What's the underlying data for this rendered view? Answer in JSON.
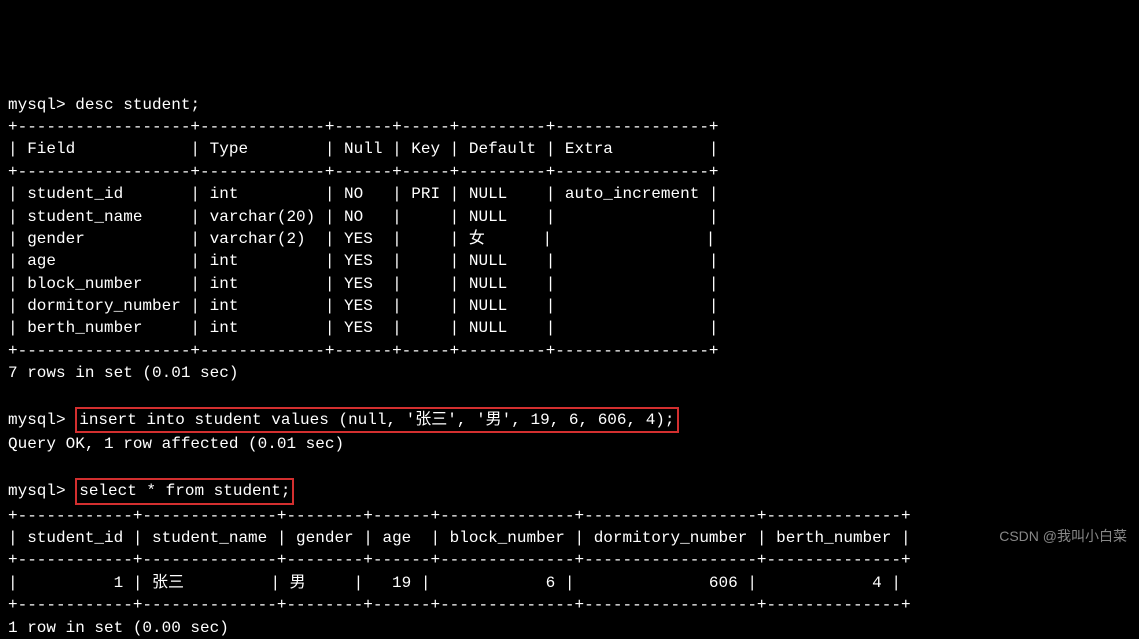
{
  "prompt": "mysql>",
  "cmd_desc": "desc student;",
  "desc_border_top": "+------------------+-------------+------+-----+---------+----------------+",
  "desc_header": "| Field            | Type        | Null | Key | Default | Extra          |",
  "desc_border_mid": "+------------------+-------------+------+-----+---------+----------------+",
  "desc_rows": [
    "| student_id       | int         | NO   | PRI | NULL    | auto_increment |",
    "| student_name     | varchar(20) | NO   |     | NULL    |                |",
    "| gender           | varchar(2)  | YES  |     | 女      |                |",
    "| age              | int         | YES  |     | NULL    |                |",
    "| block_number     | int         | YES  |     | NULL    |                |",
    "| dormitory_number | int         | YES  |     | NULL    |                |",
    "| berth_number     | int         | YES  |     | NULL    |                |"
  ],
  "desc_border_bot": "+------------------+-------------+------+-----+---------+----------------+",
  "desc_summary": "7 rows in set (0.01 sec)",
  "cmd_insert": "insert into student values (null, '张三', '男', 19, 6, 606, 4);",
  "insert_result": "Query OK, 1 row affected (0.01 sec)",
  "cmd_select": "select * from student;",
  "sel_border_top": "+------------+--------------+--------+------+--------------+------------------+--------------+",
  "sel_header": "| student_id | student_name | gender | age  | block_number | dormitory_number | berth_number |",
  "sel_border_mid": "+------------+--------------+--------+------+--------------+------------------+--------------+",
  "sel_rows": [
    "|          1 | 张三         | 男     |   19 |            6 |              606 |            4 |"
  ],
  "sel_border_bot": "+------------+--------------+--------+------+--------------+------------------+--------------+",
  "sel_summary": "1 row in set (0.00 sec)",
  "watermark": "CSDN @我叫小白菜"
}
